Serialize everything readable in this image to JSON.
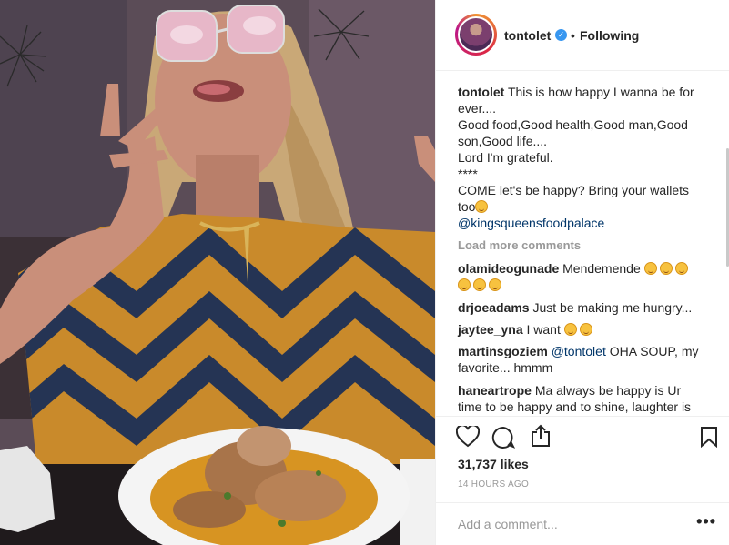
{
  "post": {
    "username": "tontolet",
    "verified_icon": "verified-badge-icon",
    "separator": "•",
    "follow_label": "Following"
  },
  "caption": {
    "user": "tontolet",
    "lines": [
      "This is how happy I wanna be for ever....",
      "Good food,Good health,Good man,Good son,Good life....",
      "Lord I'm grateful.",
      "****",
      "COME let's be happy? Bring your wallets too"
    ],
    "mention": "@kingsqueensfoodpalace"
  },
  "load_more": "Load more comments",
  "comments": [
    {
      "user": "olamideogunade",
      "text": "Mendemende",
      "emoji_count": 6
    },
    {
      "user": "drjoeadams",
      "text": "Just be making me hungry...",
      "emoji_count": 0
    },
    {
      "user": "jaytee_yna",
      "text": "I want",
      "emoji_count": 2
    },
    {
      "user": "martinsgoziem",
      "mention": "@tontolet",
      "text": "OHA SOUP, my favorite... hmmm",
      "emoji_count": 0
    },
    {
      "user": "haneartrope",
      "text": "Ma always be happy is Ur time to be happy and to shine, laughter is",
      "emoji_count": 0
    }
  ],
  "actions": {
    "icons": [
      "heart-icon",
      "comment-icon",
      "share-icon",
      "bookmark-icon"
    ],
    "likes": "31,737 likes",
    "time": "14 HOURS AGO"
  },
  "add_comment": {
    "placeholder": "Add a comment...",
    "more_label": "•••"
  },
  "colors": {
    "accent_blue": "#3897f0",
    "text": "#262626",
    "muted": "#999999",
    "mention": "#003569",
    "dress_orange": "#c98a2b",
    "dress_navy": "#253454"
  }
}
